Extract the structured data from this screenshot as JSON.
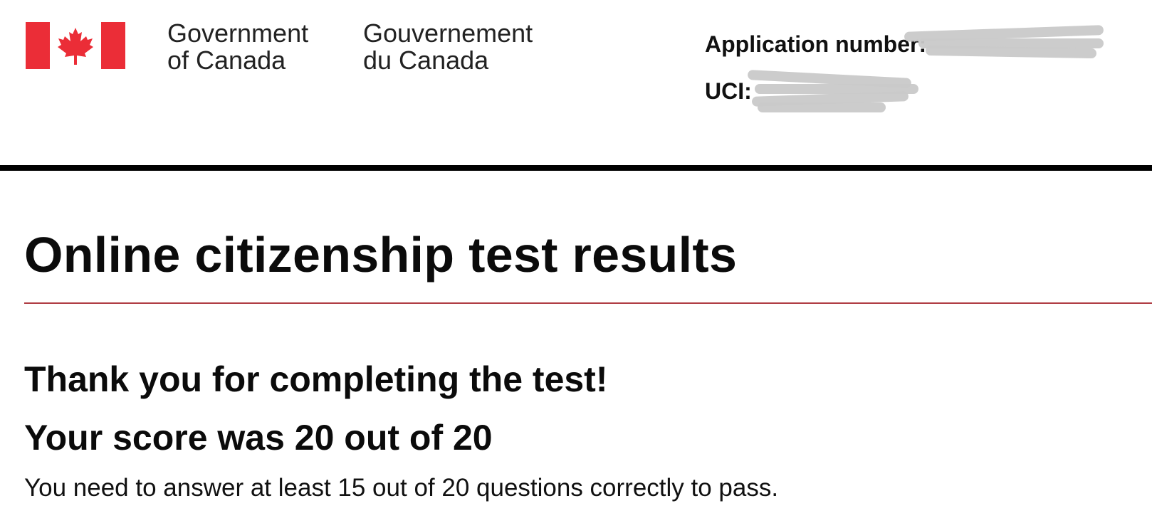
{
  "header": {
    "gov_en_line1": "Government",
    "gov_en_line2": "of Canada",
    "gov_fr_line1": "Gouvernement",
    "gov_fr_line2": "du Canada",
    "flag_icon": "canada-flag-icon",
    "flag_colors": {
      "red": "#eb2d37",
      "white": "#ffffff"
    },
    "application_number_label": "Application number:",
    "uci_label": "UCI:"
  },
  "main": {
    "title": "Online citizenship test results",
    "thanks": "Thank you for completing the test!",
    "score": "Your score was 20 out of 20",
    "requirement": "You need to answer at least 15 out of 20 questions correctly to pass."
  },
  "colors": {
    "title_rule": "#af3c43",
    "header_rule": "#000000",
    "redaction": "#c9c9c9"
  }
}
